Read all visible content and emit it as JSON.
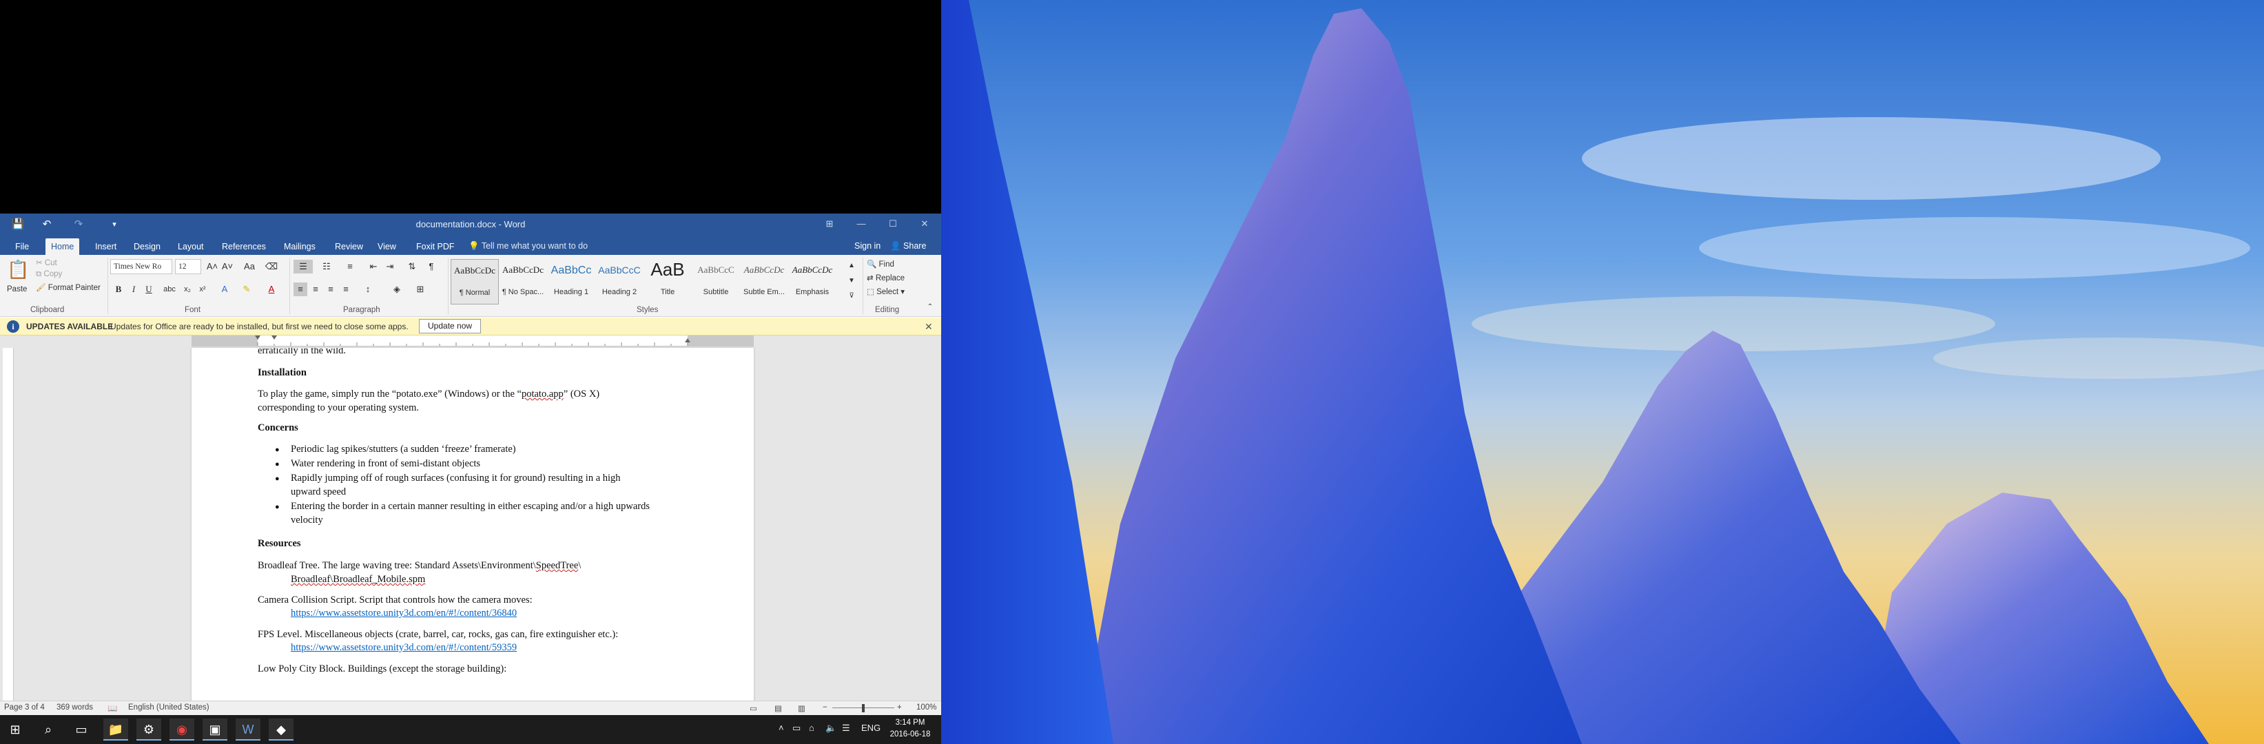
{
  "window": {
    "title": "documentation.docx - Word",
    "controls": {
      "ribbon_options": "⊞",
      "minimize": "—",
      "maximize": "☐",
      "close": "✕"
    }
  },
  "qat": {
    "save": "💾",
    "undo": "↶",
    "redo": "↷",
    "customize": "▾"
  },
  "tabs": [
    "File",
    "Home",
    "Insert",
    "Design",
    "Layout",
    "References",
    "Mailings",
    "Review",
    "View",
    "Foxit PDF"
  ],
  "active_tab": "Home",
  "tell_me": "Tell me what you want to do",
  "sign_in": "Sign in",
  "share": "Share",
  "ribbon": {
    "clipboard": {
      "paste": "Paste",
      "cut": "Cut",
      "copy": "Copy",
      "format_painter": "Format Painter",
      "label": "Clipboard"
    },
    "font": {
      "name": "Times New Ro",
      "size": "12",
      "bold": "B",
      "italic": "I",
      "underline": "U",
      "label": "Font"
    },
    "paragraph": {
      "label": "Paragraph"
    },
    "styles": {
      "label": "Styles",
      "items": [
        {
          "sample": "AaBbCcDc",
          "name": "¶ Normal"
        },
        {
          "sample": "AaBbCcDc",
          "name": "¶ No Spac..."
        },
        {
          "sample": "AaBbCc",
          "name": "Heading 1"
        },
        {
          "sample": "AaBbCcC",
          "name": "Heading 2"
        },
        {
          "sample": "AaB",
          "name": "Title"
        },
        {
          "sample": "AaBbCcC",
          "name": "Subtitle"
        },
        {
          "sample": "AaBbCcDc",
          "name": "Subtle Em..."
        },
        {
          "sample": "AaBbCcDc",
          "name": "Emphasis"
        }
      ]
    },
    "editing": {
      "find": "Find",
      "replace": "Replace",
      "select": "Select",
      "label": "Editing"
    }
  },
  "message_bar": {
    "title": "UPDATES AVAILABLE",
    "text": "Updates for Office are ready to be installed, but first we need to close some apps.",
    "button": "Update now"
  },
  "document": {
    "cut_line": "erratically in the wild.",
    "installation_heading": "Installation",
    "installation_p1a": "To play the game, simply run the “potato.exe” (Windows) or the “",
    "installation_p1b": "potato.app",
    "installation_p1c": "” (OS X)",
    "installation_p2": "corresponding to your operating system.",
    "concerns_heading": "Concerns",
    "concerns": [
      [
        "Periodic lag spikes/stutters (a sudden ‘freeze’ framerate)"
      ],
      [
        "Water rendering in front of semi-distant objects"
      ],
      [
        "Rapidly jumping off of rough surfaces (confusing it for ground) resulting in a high",
        "upward speed"
      ],
      [
        "Entering the border in a certain manner resulting in either escaping and/or a high upwards",
        "velocity"
      ]
    ],
    "resources_heading": "Resources",
    "res1a": "Broadleaf Tree. The large waving tree: Standard Assets\\Environment\\",
    "res1b": "SpeedTree",
    "res1c": "\\",
    "res1d": "Broadleaf\\Broadleaf_",
    "res1e": "Mobile.spm",
    "res2": "Camera Collision Script. Script that controls how the camera moves:",
    "res2_link": "https://www.assetstore.unity3d.com/en/#!/content/36840",
    "res3": "FPS Level. Miscellaneous objects (crate, barrel, car, rocks, gas can, fire extinguisher etc.):",
    "res3_link": "https://www.assetstore.unity3d.com/en/#!/content/59359",
    "res4": "Low Poly City Block. Buildings (except the storage building):"
  },
  "status": {
    "page": "Page 3 of 4",
    "words": "369 words",
    "language": "English (United States)",
    "zoom": "100%"
  },
  "taskbar": {
    "tray_language": "ENG",
    "time": "3:14 PM",
    "date": "2016-06-18"
  },
  "colors": {
    "word_blue": "#2b579a",
    "sky_top": "#3d80d6",
    "sky_bottom": "#f1c24e",
    "mountain": "#1f58dc"
  }
}
